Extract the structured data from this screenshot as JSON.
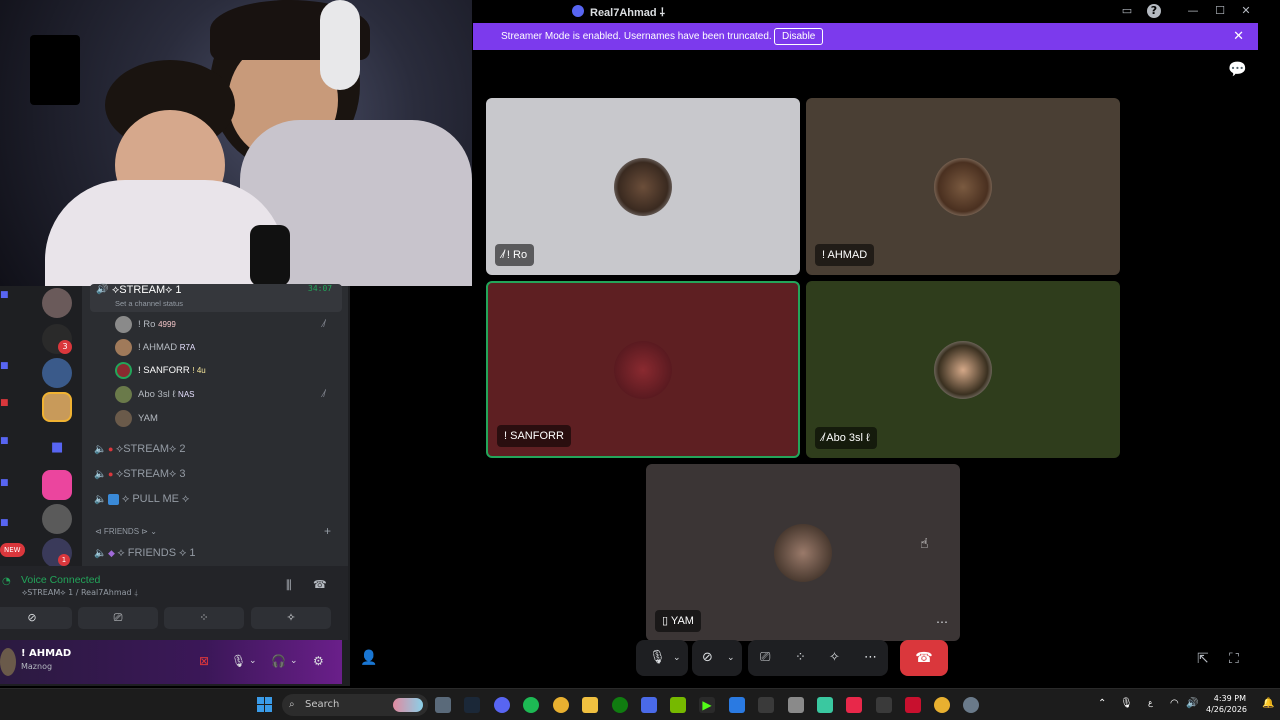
{
  "window": {
    "title": "Real7Ahmad ⸸"
  },
  "banner": {
    "text": "Streamer Mode is enabled. Usernames have been truncated.",
    "button": "Disable"
  },
  "tiles": [
    {
      "name": "! Ro",
      "muted": true,
      "bg": "#c8c8cc"
    },
    {
      "name": "! AHMAD",
      "muted": false,
      "bg": "#4a3f34"
    },
    {
      "name": "! SANFORR",
      "muted": false,
      "bg": "#5e1f22",
      "speaking": true
    },
    {
      "name": "Abo 3sl ℓ",
      "muted": true,
      "bg": "#2f3d1c"
    },
    {
      "name": "YAM",
      "mobile": true,
      "bg": "#3b3535"
    }
  ],
  "sidebar": {
    "channel_stream1": "⟡STREAM⟡ 1",
    "channel_status": "Set a channel status",
    "channel_time": "34:07",
    "members": [
      {
        "name": "! Ro",
        "tag": "4999",
        "muted": true
      },
      {
        "name": "! AHMAD",
        "tag": "R7A",
        "muted": false
      },
      {
        "name": "! SANFORR",
        "tag": "! 4u",
        "muted": false
      },
      {
        "name": "Abo 3sl ℓ",
        "tag": "NAS",
        "muted": true
      },
      {
        "name": "YAM",
        "tag": "",
        "muted": false
      }
    ],
    "channel_stream2": "⟡STREAM⟡ 2",
    "channel_stream3": "⟡STREAM⟡ 3",
    "channel_pullme": "⟡ PULL ME ⟡",
    "category_friends": "⊲ FRIENDS ⊳",
    "channel_friends1": "⟡ FRIENDS ⟡ 1",
    "new_badge": "NEW",
    "badge_3": "3",
    "badge_1": "1"
  },
  "voice": {
    "title": "Voice Connected",
    "subtitle": "⟡STREAM⟡ 1 / Real7Ahmad ⸸"
  },
  "user": {
    "name": "! AHMAD",
    "status": "Maznog"
  },
  "taskbar": {
    "search": "Search",
    "time": "4:39 PM",
    "date": "4/26/2026"
  }
}
